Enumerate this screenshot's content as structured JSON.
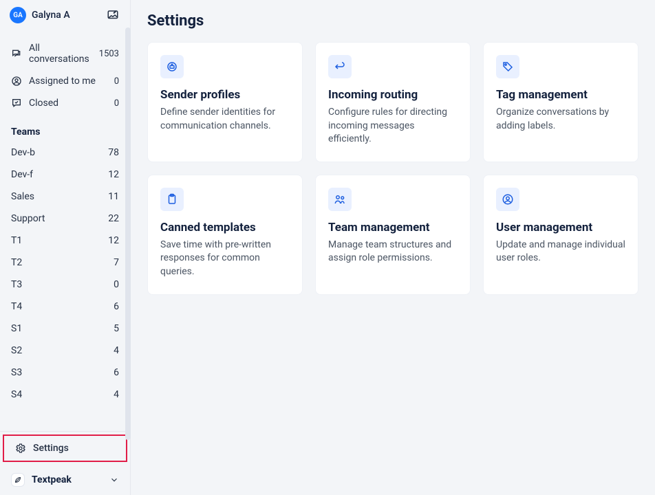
{
  "user": {
    "initials": "GA",
    "name": "Galyna A"
  },
  "nav": {
    "items": [
      {
        "label": "All conversations",
        "count": "1503"
      },
      {
        "label": "Assigned to me",
        "count": "0"
      },
      {
        "label": "Closed",
        "count": "0"
      }
    ]
  },
  "teams": {
    "header": "Teams",
    "items": [
      {
        "name": "Dev-b",
        "count": "78"
      },
      {
        "name": "Dev-f",
        "count": "12"
      },
      {
        "name": "Sales",
        "count": "11"
      },
      {
        "name": "Support",
        "count": "22"
      },
      {
        "name": "T1",
        "count": "12"
      },
      {
        "name": "T2",
        "count": "7"
      },
      {
        "name": "T3",
        "count": "0"
      },
      {
        "name": "T4",
        "count": "6"
      },
      {
        "name": "S1",
        "count": "5"
      },
      {
        "name": "S2",
        "count": "4"
      },
      {
        "name": "S3",
        "count": "6"
      },
      {
        "name": "S4",
        "count": "4"
      }
    ]
  },
  "settings_label": "Settings",
  "org_name": "Textpeak",
  "page": {
    "title": "Settings",
    "cards": [
      {
        "title": "Sender profiles",
        "desc": "Define sender identities for communication channels."
      },
      {
        "title": "Incoming routing",
        "desc": "Configure rules for directing incoming messages efficiently."
      },
      {
        "title": "Tag management",
        "desc": "Organize conversations by adding labels."
      },
      {
        "title": "Canned templates",
        "desc": "Save time with pre-written responses for common queries."
      },
      {
        "title": "Team management",
        "desc": "Manage team structures and assign role permissions."
      },
      {
        "title": "User management",
        "desc": "Update and manage individual user roles."
      }
    ]
  }
}
